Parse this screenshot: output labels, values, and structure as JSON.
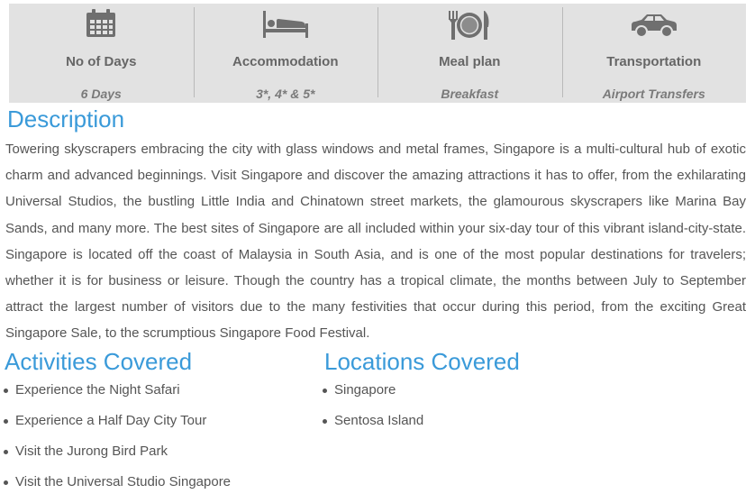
{
  "info": [
    {
      "icon": "calendar-icon",
      "label": "No of Days",
      "value": "6 Days"
    },
    {
      "icon": "bed-icon",
      "label": "Accommodation",
      "value": "3*, 4* & 5*"
    },
    {
      "icon": "meal-icon",
      "label": "Meal plan",
      "value": "Breakfast"
    },
    {
      "icon": "car-icon",
      "label": "Transportation",
      "value": "Airport Transfers"
    }
  ],
  "description": {
    "heading": "Description",
    "text": "Towering skyscrapers embracing the city with glass windows and metal frames, Singapore is a multi-cultural hub of exotic charm and advanced beginnings. Visit Singapore and discover the amazing attractions it has to offer, from the exhilarating Universal Studios, the bustling Little India and Chinatown street markets, the glamourous skyscrapers like Marina Bay Sands, and many more. The best sites of Singapore are all included within your six-day tour of this vibrant island-city-state. Singapore is located off the coast of Malaysia in South Asia, and is one of the most popular destinations for travelers; whether it is for business or leisure. Though the country has a tropical climate, the months between July to September attract the largest number of visitors due to the many festivities that occur during this period, from the exciting Great Singapore Sale, to the scrumptious Singapore Food Festival."
  },
  "activities": {
    "heading": "Activities Covered",
    "items": [
      "Experience the Night Safari",
      "Experience a Half Day City Tour",
      "Visit the Jurong Bird Park",
      "Visit the Universal Studio Singapore"
    ]
  },
  "locations": {
    "heading": "Locations Covered",
    "items": [
      "Singapore",
      "Sentosa Island"
    ]
  },
  "colors": {
    "heading": "#3a9ad9",
    "info_bg": "#e2e2e2",
    "icon": "#6f6f6f"
  }
}
